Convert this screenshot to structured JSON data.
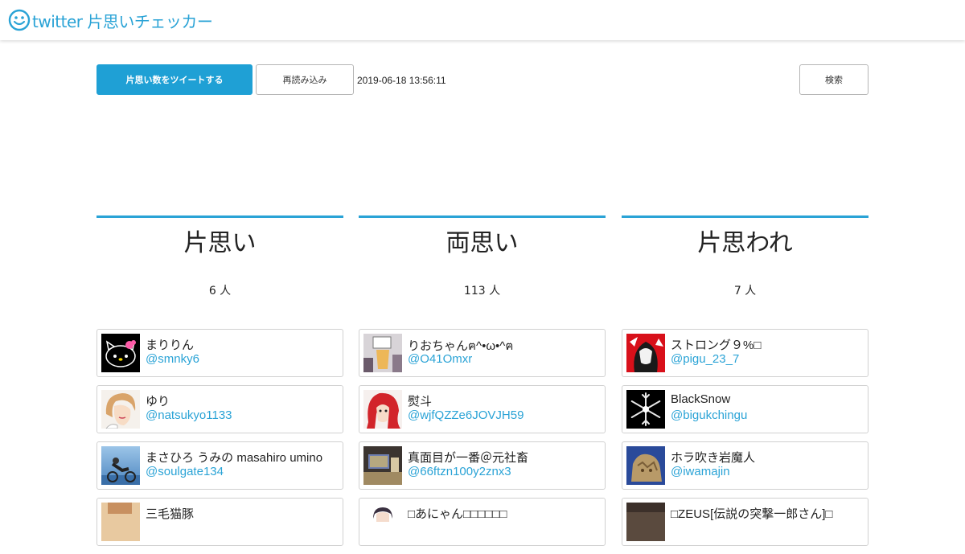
{
  "header": {
    "title": "twitter 片思いチェッカー",
    "logo_icon": "smiley-icon",
    "accent": "#2aa3d6"
  },
  "toolbar": {
    "tweet_label": "片思い数をツイートする",
    "reload_label": "再読み込み",
    "timestamp": "2019-06-18 13:56:11",
    "search_label": "検索"
  },
  "columns": [
    {
      "title": "片思い",
      "count": "6 人",
      "users": [
        {
          "name": "まりりん",
          "handle": "@smnky6",
          "avatar": "hello-kitty-avatar"
        },
        {
          "name": "ゆり",
          "handle": "@natsukyo1133",
          "avatar": "drawn-face-avatar"
        },
        {
          "name": "まさひろ うみの masahiro umino",
          "handle": "@soulgate134",
          "avatar": "cyclist-photo-avatar"
        },
        {
          "name": "三毛猫豚",
          "handle": "",
          "avatar": "photo-avatar"
        }
      ]
    },
    {
      "title": "両思い",
      "count": "113 人",
      "users": [
        {
          "name": "りおちゃんฅ^•ω•^ฅ",
          "handle": "@O41Omxr",
          "avatar": "drink-photo-avatar"
        },
        {
          "name": "熨斗",
          "handle": "@wjfQZZe6JOVJH59",
          "avatar": "red-hair-anime-avatar"
        },
        {
          "name": "真面目が一番＠元社畜",
          "handle": "@66ftzn100y2znx3",
          "avatar": "desk-photo-avatar"
        },
        {
          "name": "□あにゃん□□□□□□",
          "handle": "",
          "avatar": "anime-avatar"
        }
      ]
    },
    {
      "title": "片思われ",
      "count": "7 人",
      "users": [
        {
          "name": "ストロング９%□",
          "handle": "@pigu_23_7",
          "avatar": "red-art-avatar"
        },
        {
          "name": "BlackSnow",
          "handle": "@bigukchingu",
          "avatar": "snowflake-avatar"
        },
        {
          "name": "ホラ吹き岩魔人",
          "handle": "@iwamajin",
          "avatar": "rock-golem-avatar"
        },
        {
          "name": "□ZEUS[伝説の突撃一郎さん]□",
          "handle": "",
          "avatar": "photo-avatar"
        }
      ]
    }
  ]
}
